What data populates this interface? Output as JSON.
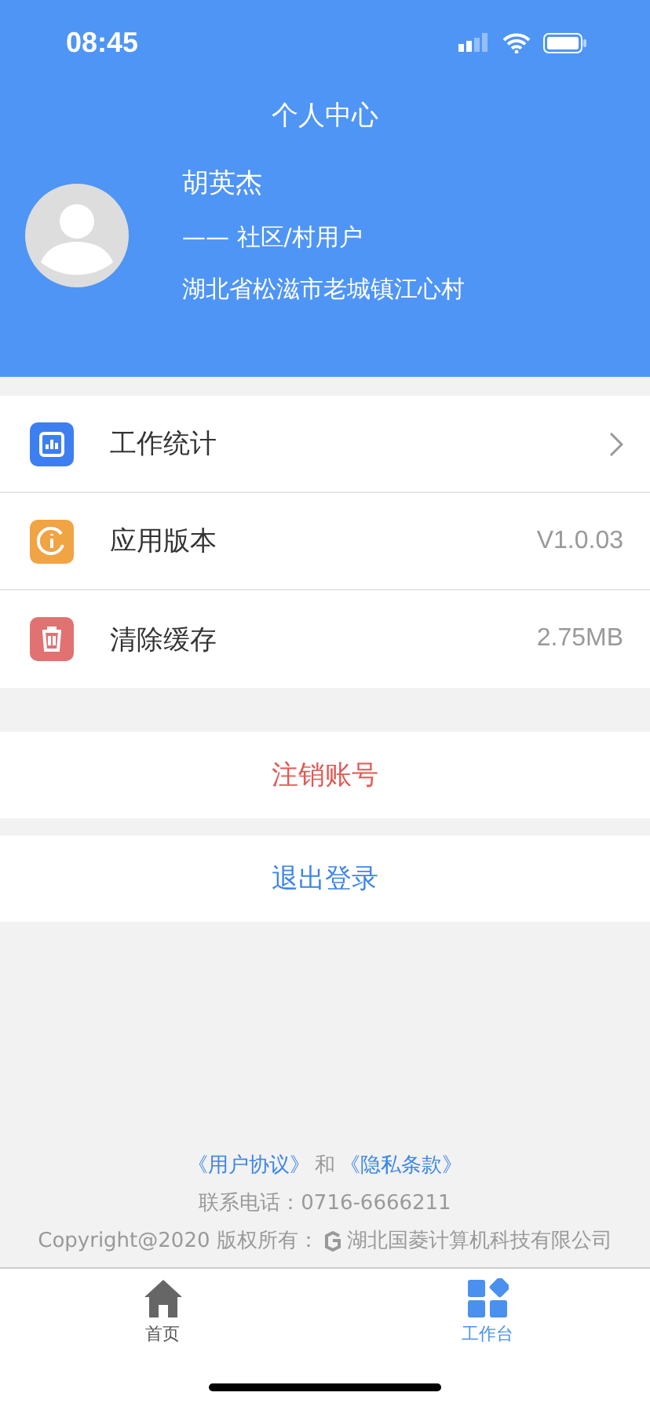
{
  "status_bar": {
    "time": "08:45"
  },
  "header": {
    "title": "个人中心",
    "name": "胡英杰",
    "role": "—— 社区/村用户",
    "address": "湖北省松滋市老城镇江心村"
  },
  "menu": [
    {
      "label": "工作统计",
      "kind": "chevron",
      "color": "#3d7ff0"
    },
    {
      "label": "应用版本",
      "kind": "value",
      "value": "V1.0.03",
      "color": "#f0a444"
    },
    {
      "label": "清除缓存",
      "kind": "value",
      "value": "2.75MB",
      "color": "#e07272"
    }
  ],
  "actions": [
    {
      "label": "注销账号",
      "color": "#e05a55"
    },
    {
      "label": "退出登录",
      "color": "#3d86e6"
    }
  ],
  "footer": {
    "agreement": "《用户协议》",
    "and": "和",
    "privacy": "《隐私条款》",
    "phone": "联系电话：0716-6666211",
    "copyright": "Copyright@2020 版权所有：",
    "company": "湖北国菱计算机科技有限公司"
  },
  "tabs": [
    {
      "label": "首页",
      "selected": false
    },
    {
      "label": "工作台",
      "selected": true
    }
  ]
}
